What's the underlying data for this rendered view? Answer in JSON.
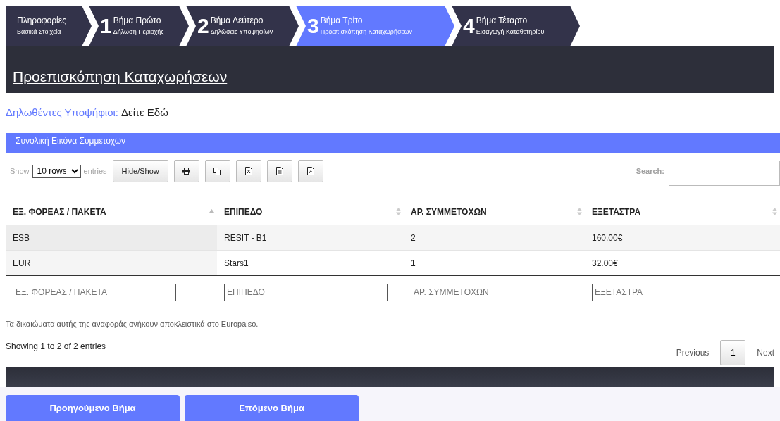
{
  "steps": [
    {
      "title": "Πληροφορίες",
      "subtitle": "Βασικά Στοιχεία",
      "selected": false
    },
    {
      "number": "1",
      "title": "Βήμα Πρώτο",
      "subtitle": "Δήλωση Περιοχής",
      "selected": false
    },
    {
      "number": "2",
      "title": "Βήμα Δεύτερο",
      "subtitle": "Δηλώσεις Υποψηφίων",
      "selected": false
    },
    {
      "number": "3",
      "title": "Βήμα Τρίτο",
      "subtitle": "Προεπισκόπηση Καταχωρήσεων",
      "selected": true
    },
    {
      "number": "4",
      "title": "Βήμα Τέταρτο",
      "subtitle": "Εισαγωγή Καταθετηρίου",
      "selected": false
    }
  ],
  "page_title": "Προεπισκόπηση Καταχωρήσεων",
  "candidates": {
    "label": "Δηλωθέντες Υποψήφιοι:",
    "link": "Δείτε Εδώ"
  },
  "panel_title": "Συνολική Εικόνα Συμμετοχών",
  "toolbar": {
    "show_prefix": "Show",
    "rows_select": "10 rows",
    "show_suffix": "entries",
    "hide_show": "Hide/Show",
    "export_buttons": [
      {
        "kind": "print"
      },
      {
        "kind": "copy"
      },
      {
        "kind": "excel"
      },
      {
        "kind": "csv"
      },
      {
        "kind": "pdf"
      }
    ],
    "search_label": "Search:"
  },
  "table": {
    "columns": [
      {
        "label": "ΕΞ. ΦΟΡΕΑΣ / ΠΑΚΕΤΑ",
        "sorted": true
      },
      {
        "label": "ΕΠΙΠΕΔΟ",
        "sorted": false
      },
      {
        "label": "ΑΡ. ΣΥΜΜΕΤΟΧΩΝ",
        "sorted": false
      },
      {
        "label": "ΕΞΕΤΑΣΤΡΑ",
        "sorted": false
      }
    ],
    "rows": [
      [
        "ESB",
        "RESIT - B1",
        "2",
        "160.00€"
      ],
      [
        "EUR",
        "Stars1",
        "1",
        "32.00€"
      ]
    ],
    "filters": [
      {
        "placeholder": "ΕΞ. ΦΟΡΕΑΣ / ΠΑΚΕΤΑ"
      },
      {
        "placeholder": "ΕΠΙΠΕΔΟ"
      },
      {
        "placeholder": "ΑΡ. ΣΥΜΜΕΤΟΧΩΝ"
      },
      {
        "placeholder": "ΕΞΕΤΑΣΤΡΑ"
      }
    ]
  },
  "copyright": "Τα δικαιώματα αυτής της αναφοράς ανήκουν αποκλειστικά στο Europalso.",
  "info": "Showing 1 to 2 of 2 entries",
  "pagination": {
    "previous": "Previous",
    "pages": [
      {
        "label": "1",
        "selected": true
      }
    ],
    "next": "Next"
  },
  "buttons": [
    "Προηγούμενο Βήμα",
    "Επόμενο Βήμα"
  ]
}
